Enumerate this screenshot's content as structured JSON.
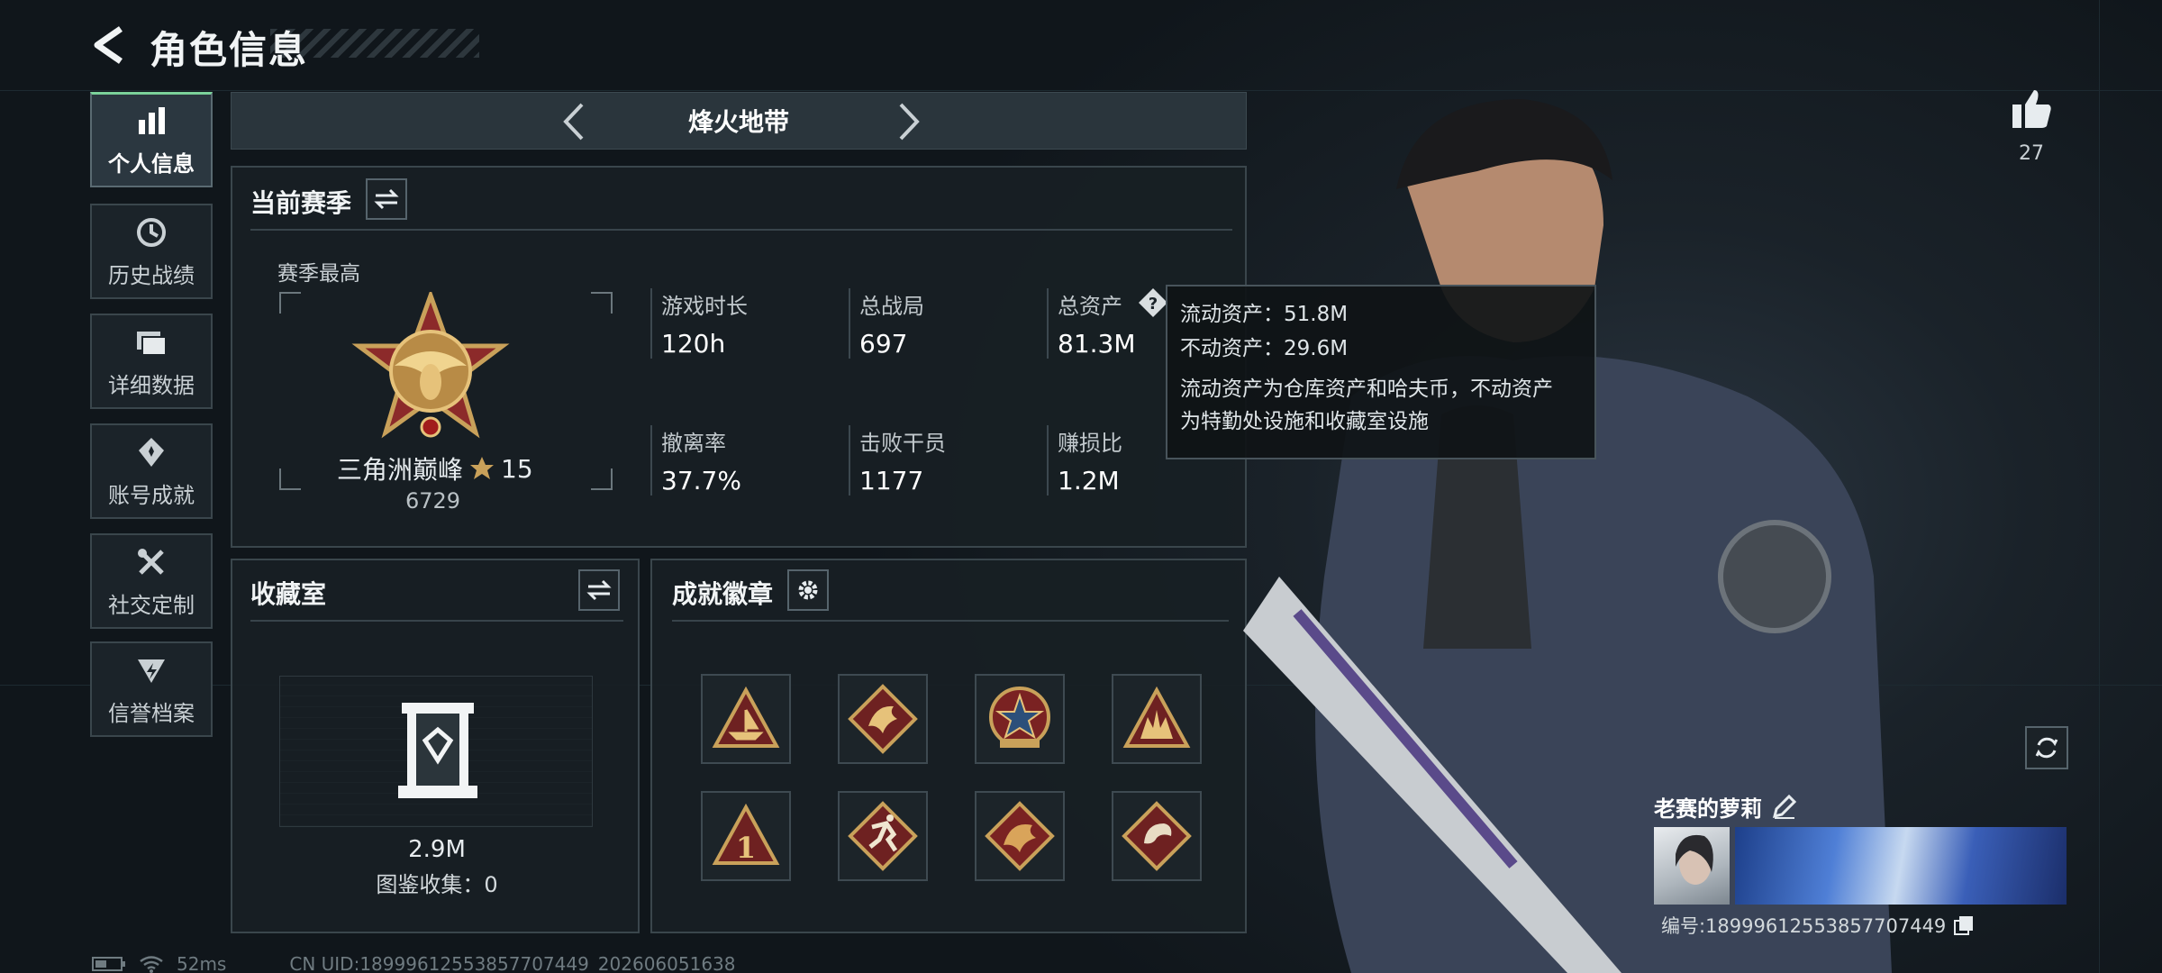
{
  "header": {
    "title": "角色信息"
  },
  "sidebar": {
    "items": [
      {
        "label": "个人信息",
        "icon": "bar-chart-icon",
        "active": true
      },
      {
        "label": "历史战绩",
        "icon": "clock-icon",
        "active": false
      },
      {
        "label": "详细数据",
        "icon": "folder-icon",
        "active": false
      },
      {
        "label": "账号成就",
        "icon": "medal-icon",
        "active": false
      },
      {
        "label": "社交定制",
        "icon": "wrench-icon",
        "active": false
      },
      {
        "label": "信誉档案",
        "icon": "shield-icon",
        "active": false
      }
    ]
  },
  "map_selector": {
    "name": "烽火地带"
  },
  "season": {
    "title": "当前赛季",
    "best_label": "赛季最高",
    "rank_name": "三角洲巅峰",
    "rank_stars": "15",
    "rank_score": "6729",
    "stats": [
      {
        "label": "游戏时长",
        "value": "120h"
      },
      {
        "label": "总战局",
        "value": "697"
      },
      {
        "label": "总资产",
        "value": "81.3M"
      },
      {
        "label": "撤离率",
        "value": "37.7%"
      },
      {
        "label": "击败干员",
        "value": "1177"
      },
      {
        "label": "赚损比",
        "value": "1.2M"
      }
    ]
  },
  "tooltip": {
    "liquid": "流动资产：51.8M",
    "fixed": "不动资产：29.6M",
    "desc_line1": "流动资产为仓库资产和哈夫币，不动资产",
    "desc_line2": "为特勤处设施和收藏室设施"
  },
  "collection": {
    "title": "收藏室",
    "value": "2.9M",
    "gallery": "图鉴收集：0"
  },
  "achievements": {
    "title": "成就徽章",
    "badges": [
      "sailboat-badge-icon",
      "dragon-badge-icon",
      "star-badge-icon",
      "hands-badge-icon",
      "number-one-badge-icon",
      "runner-badge-icon",
      "dragon-red-badge-icon",
      "snake-badge-icon"
    ]
  },
  "profile": {
    "likes": "27",
    "player_name": "老赛的萝莉",
    "id_label": "编号:18999612553857707449"
  },
  "status_bar": {
    "ping": "52ms",
    "uid": "CN UID:18999612553857707449_202606051638"
  },
  "colors": {
    "accent_green": "#7bd19a",
    "gold": "#c9a15a"
  }
}
